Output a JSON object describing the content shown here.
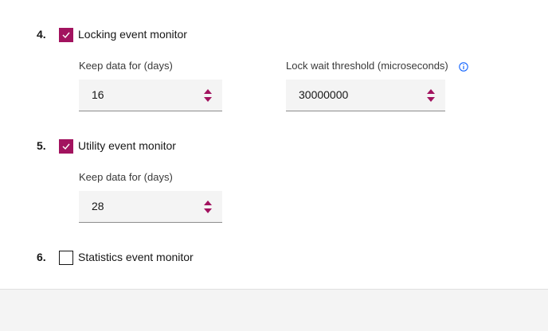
{
  "colors": {
    "accent": "#a2135f",
    "info": "#0f62fe"
  },
  "monitors": [
    {
      "number": "4.",
      "title": "Locking event monitor",
      "checked": true,
      "fields": [
        {
          "label": "Keep data for (days)",
          "value": "16"
        },
        {
          "label": "Lock wait threshold (microseconds)",
          "value": "30000000",
          "info_icon": "info-icon"
        }
      ]
    },
    {
      "number": "5.",
      "title": "Utility event monitor",
      "checked": true,
      "fields": [
        {
          "label": "Keep data for (days)",
          "value": "28"
        }
      ]
    },
    {
      "number": "6.",
      "title": "Statistics event monitor",
      "checked": false,
      "fields": []
    }
  ]
}
